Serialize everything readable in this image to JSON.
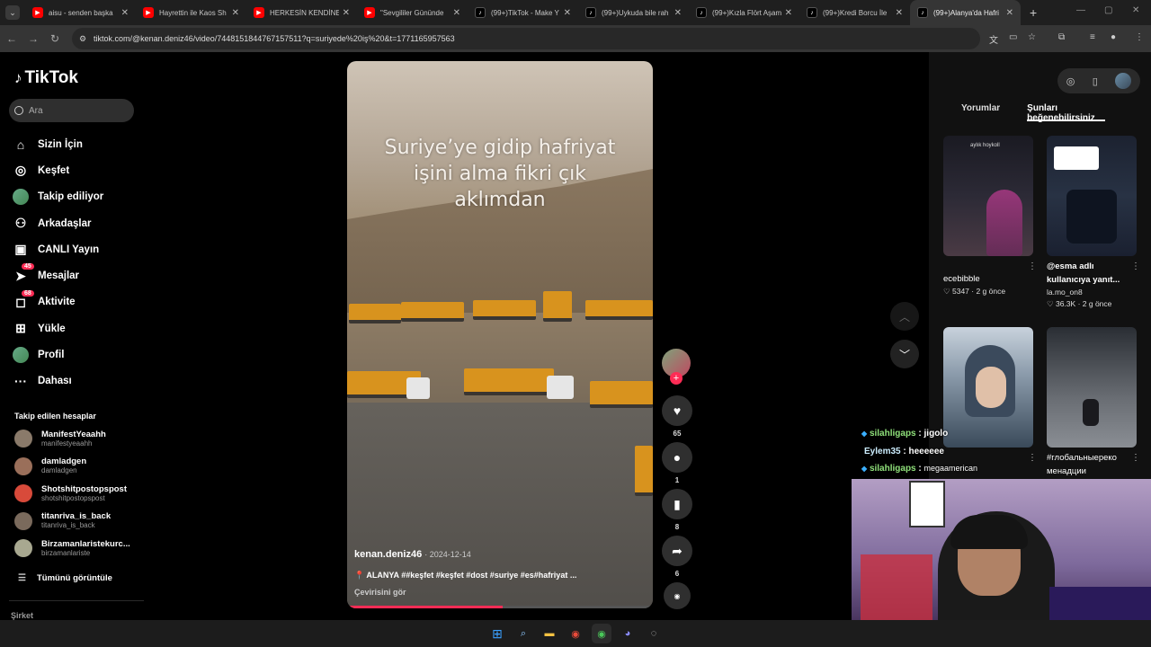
{
  "browser": {
    "tabs": [
      {
        "title": "aisu - senden başka",
        "kind": "yt"
      },
      {
        "title": "Hayrettin ile Kaos Sh",
        "kind": "yt"
      },
      {
        "title": "HERKESİN KENDİNE",
        "kind": "yt"
      },
      {
        "title": "\"Sevgililer Gününde",
        "kind": "yt"
      },
      {
        "title": "(99+)TikTok - Make Y",
        "kind": "tt"
      },
      {
        "title": "(99+)Uykuda bile rah",
        "kind": "tt"
      },
      {
        "title": "(99+)Kızla Flört Aşam",
        "kind": "tt"
      },
      {
        "title": "(99+)Kredi Borcu İle",
        "kind": "tt"
      },
      {
        "title": "(99+)Alanya'da Hafri",
        "kind": "tt",
        "active": true
      }
    ],
    "new_tab": "+",
    "url": "tiktok.com/@kenan.deniz46/video/7448151844767157511?q=suriyede%20iş%20&t=1771165957563"
  },
  "sidebar": {
    "logo": "TikTok",
    "search_placeholder": "Ara",
    "menu": [
      {
        "label": "Sizin İçin",
        "icon": "home-icon",
        "glyph": "⌂"
      },
      {
        "label": "Keşfet",
        "icon": "compass-icon",
        "glyph": "◎"
      },
      {
        "label": "Takip ediliyor",
        "icon": "following-avatar",
        "glyph": ""
      },
      {
        "label": "Arkadaşlar",
        "icon": "friends-icon",
        "glyph": "⚇"
      },
      {
        "label": "CANLI Yayın",
        "icon": "live-icon",
        "glyph": "▣"
      },
      {
        "label": "Mesajlar",
        "icon": "messages-icon",
        "glyph": "➤",
        "badge": "45"
      },
      {
        "label": "Aktivite",
        "icon": "activity-icon",
        "glyph": "◻",
        "badge": "68"
      },
      {
        "label": "Yükle",
        "icon": "upload-icon",
        "glyph": "⊞"
      },
      {
        "label": "Profil",
        "icon": "profile-avatar",
        "glyph": ""
      },
      {
        "label": "Dahası",
        "icon": "more-icon",
        "glyph": "···"
      }
    ],
    "following_title": "Takip edilen hesaplar",
    "following": [
      {
        "name": "ManifestYeaahh",
        "handle": "manifestyeaahh",
        "color": "#8a7a6a"
      },
      {
        "name": "damladgen",
        "handle": "damladgen",
        "color": "#9a6f5a"
      },
      {
        "name": "Shotshitpostopspost",
        "handle": "shotshitpostopspost",
        "color": "#d84a3a"
      },
      {
        "name": "titanriva_is_back",
        "handle": "titanriva_is_back",
        "color": "#7a6a5c"
      },
      {
        "name": "Birzamanlaristekurc...",
        "handle": "birzamanlariste",
        "color": "#a8a890"
      }
    ],
    "see_all": "Tümünü görüntüle",
    "company": "Şirket"
  },
  "video": {
    "caption": "Suriye’ye gidip hafriyat işini alma fikri çık aklımdan",
    "author": "kenan.deniz46",
    "date": "2024-12-14",
    "description": "📍 ALANYA ##keşfet #keşfet #dost #suriye #es#hafriyat ...",
    "translate": "Çevirisini gör",
    "progress": 0.51
  },
  "actions": {
    "likes": "65",
    "comments": "1",
    "saves": "8",
    "shares": "6"
  },
  "right": {
    "tabs": [
      "Yorumlar",
      "Şunları beğenebilirsiniz"
    ],
    "cards": [
      {
        "title": "ecebibble",
        "likes": "5347",
        "time": "2 g önce",
        "overlay": "aylık hoykoll"
      },
      {
        "title": "@esma adlı kullanıcıya yanıt...",
        "author": "la.mo_on8",
        "likes": "36.3K",
        "time": "2 g önce"
      },
      {
        "title": "",
        "likes": "",
        "time": ""
      },
      {
        "title": "#глобальныереко менадции",
        "likes": "",
        "time": ""
      }
    ]
  },
  "chat": [
    {
      "user": "silahligaps",
      "sep": ":",
      "msg": "jigolo",
      "badge": true
    },
    {
      "user": "Eylem35",
      "sep": ":",
      "msg": "heeeeee",
      "badge": false
    },
    {
      "user": "silahligaps",
      "sep": ":",
      "msg": "megaamerican",
      "badge": true
    }
  ]
}
